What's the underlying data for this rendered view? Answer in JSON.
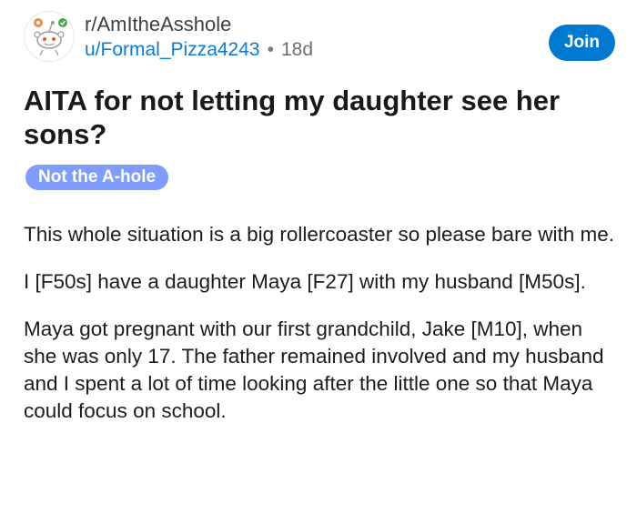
{
  "header": {
    "subreddit": "r/AmItheAsshole",
    "author": "u/Formal_Pizza4243",
    "separator": "•",
    "age": "18d",
    "join_label": "Join"
  },
  "post": {
    "title": "AITA for not letting my daughter see her sons?",
    "flair": "Not the A-hole",
    "paragraphs": [
      "This whole situation is a big rollercoaster so please bare with me.",
      "I [F50s] have a daughter Maya [F27] with my husband [M50s].",
      "Maya got pregnant with our first grandchild, Jake [M10], when she was only 17. The father remained involved and my husband and I spent a lot of time looking after the little one so that Maya could focus on school."
    ]
  },
  "colors": {
    "join_button": "#0079d3",
    "author_link": "#0a7bd6",
    "flair_background": "#7f9cff",
    "title_text": "#1a1a1b"
  },
  "icons": {
    "avatar": "subreddit-avatar-icon"
  }
}
